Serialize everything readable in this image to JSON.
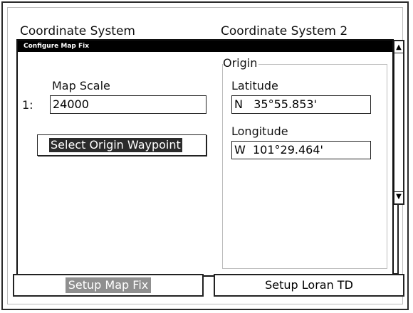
{
  "background": {
    "header_left": "Coordinate System",
    "header_right": "Coordinate System 2"
  },
  "dialog": {
    "title": "Configure Map Fix",
    "map_scale": {
      "label": "Map Scale",
      "prefix": "1:",
      "value": "24000"
    },
    "select_origin_button": "Select Origin Waypoint",
    "origin": {
      "legend": "Origin",
      "latitude_label": "Latitude",
      "latitude_value": "N   35°55.853'",
      "longitude_label": "Longitude",
      "longitude_value": "W  101°29.464'"
    }
  },
  "bottom_buttons": {
    "setup_map_fix": "Setup Map Fix",
    "setup_loran_td": "Setup Loran TD"
  },
  "scrollbar": {
    "up_icon": "up-arrow-icon",
    "down_icon": "down-arrow-icon"
  },
  "colors": {
    "title_bar": "#000000",
    "highlight": "#2b2b2b",
    "bottom_highlight": "#8f8f8f"
  }
}
